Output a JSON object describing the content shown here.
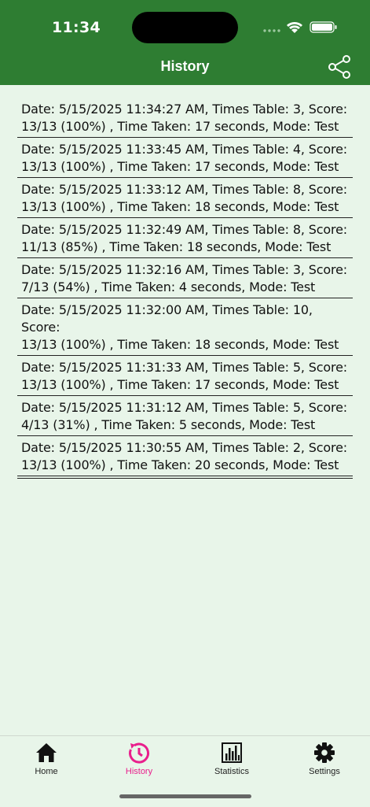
{
  "status": {
    "time": "11:34"
  },
  "header": {
    "title": "History"
  },
  "history": [
    {
      "line1": "Date: 5/15/2025 11:34:27 AM, Times Table: 3, Score:",
      "line2": "13/13 (100%) , Time Taken: 17 seconds, Mode: Test"
    },
    {
      "line1": "Date: 5/15/2025 11:33:45 AM, Times Table: 4, Score:",
      "line2": "13/13 (100%) , Time Taken: 17 seconds, Mode: Test"
    },
    {
      "line1": "Date: 5/15/2025 11:33:12 AM, Times Table: 8, Score:",
      "line2": "13/13 (100%) , Time Taken: 18 seconds, Mode: Test"
    },
    {
      "line1": "Date: 5/15/2025 11:32:49 AM, Times Table: 8, Score:",
      "line2": "11/13 (85%) , Time Taken: 18 seconds, Mode: Test"
    },
    {
      "line1": "Date: 5/15/2025 11:32:16 AM, Times Table: 3, Score:",
      "line2": "7/13 (54%) , Time Taken: 4 seconds, Mode: Test"
    },
    {
      "line1": "Date: 5/15/2025 11:32:00 AM, Times Table: 10, Score:",
      "line2": "13/13 (100%) , Time Taken: 18 seconds, Mode: Test"
    },
    {
      "line1": "Date: 5/15/2025 11:31:33 AM, Times Table: 5, Score:",
      "line2": "13/13 (100%) , Time Taken: 17 seconds, Mode: Test"
    },
    {
      "line1": "Date: 5/15/2025 11:31:12 AM, Times Table: 5, Score:",
      "line2": "4/13 (31%) , Time Taken: 5 seconds, Mode: Test"
    },
    {
      "line1": "Date: 5/15/2025 11:30:55 AM, Times Table: 2, Score:",
      "line2": "13/13 (100%) , Time Taken: 20 seconds, Mode: Test"
    }
  ],
  "tabs": [
    {
      "label": "Home",
      "icon": "home-icon"
    },
    {
      "label": "History",
      "icon": "history-icon"
    },
    {
      "label": "Statistics",
      "icon": "statistics-icon"
    },
    {
      "label": "Settings",
      "icon": "settings-icon"
    }
  ],
  "colors": {
    "header": "#2e7d32",
    "background": "#e8f5e9",
    "active_tab": "#e91e8c"
  }
}
